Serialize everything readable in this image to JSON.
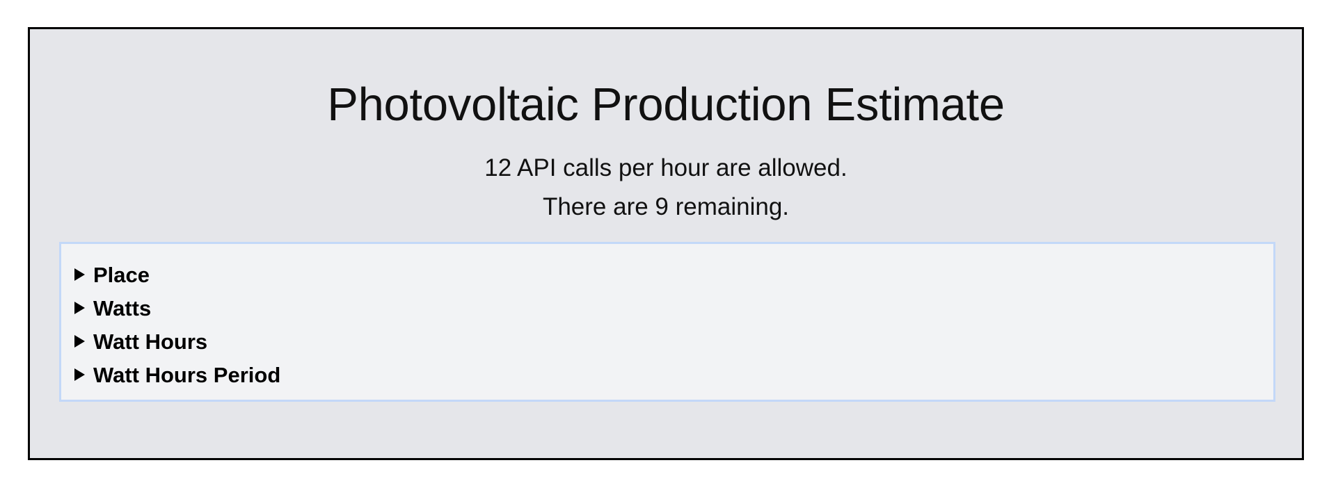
{
  "header": {
    "title": "Photovoltaic Production Estimate",
    "api_rate_text": "12 API calls per hour are allowed.",
    "api_remaining_text": "There are 9 remaining."
  },
  "sections": [
    {
      "label": "Place",
      "icon": "disclosure-triangle-right-icon",
      "expanded": false
    },
    {
      "label": "Watts",
      "icon": "disclosure-triangle-right-icon",
      "expanded": false
    },
    {
      "label": "Watt Hours",
      "icon": "disclosure-triangle-right-icon",
      "expanded": false
    },
    {
      "label": "Watt Hours Period",
      "icon": "disclosure-triangle-right-icon",
      "expanded": false
    }
  ],
  "colors": {
    "panel_background": "#e5e6ea",
    "panel_border": "#000000",
    "settings_background": "#f2f3f5",
    "settings_border": "#c3d8f8"
  }
}
